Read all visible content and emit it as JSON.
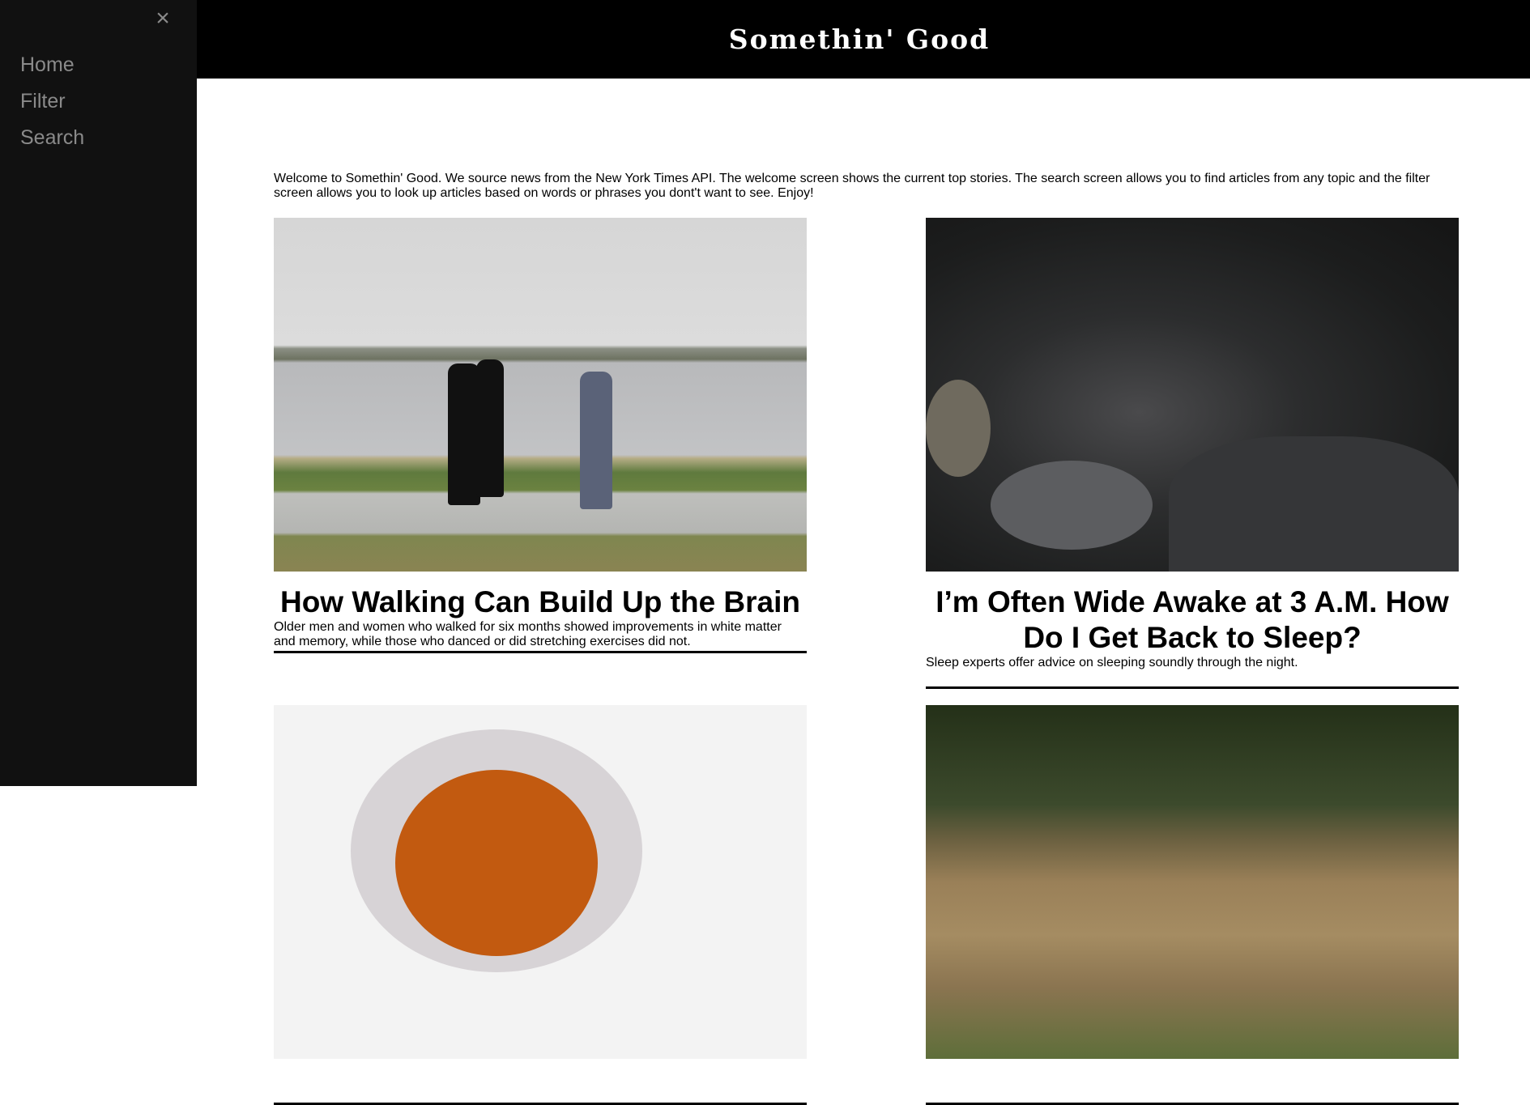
{
  "sidebar": {
    "close_icon": "×",
    "items": [
      {
        "label": "Home"
      },
      {
        "label": "Filter"
      },
      {
        "label": "Search"
      }
    ]
  },
  "header": {
    "title": "Somethin' Good"
  },
  "intro": {
    "text": "Welcome to Somethin' Good. We source news from the New York Times API. The welcome screen shows the current top stories. The search screen allows you to find articles from any topic and the filter screen allows you to look up articles based on words or phrases you dont't want to see. Enjoy!"
  },
  "articles": [
    {
      "image": "people-walking-by-lake-photo",
      "title": "How Walking Can Build Up the Brain",
      "description": "Older men and women who walked for six months showed improvements in white matter and memory, while those who danced or did stretching exercises did not."
    },
    {
      "image": "woman-awake-in-bed-photo",
      "title": "I’m Often Wide Awake at 3 A.M. How Do I Get Back to Sleep?",
      "description": "Sleep experts offer advice on sleeping soundly through the night."
    },
    {
      "image": "soup-bowl-photo",
      "title": "",
      "description": ""
    },
    {
      "image": "forest-basin-photo",
      "title": "",
      "description": ""
    }
  ]
}
